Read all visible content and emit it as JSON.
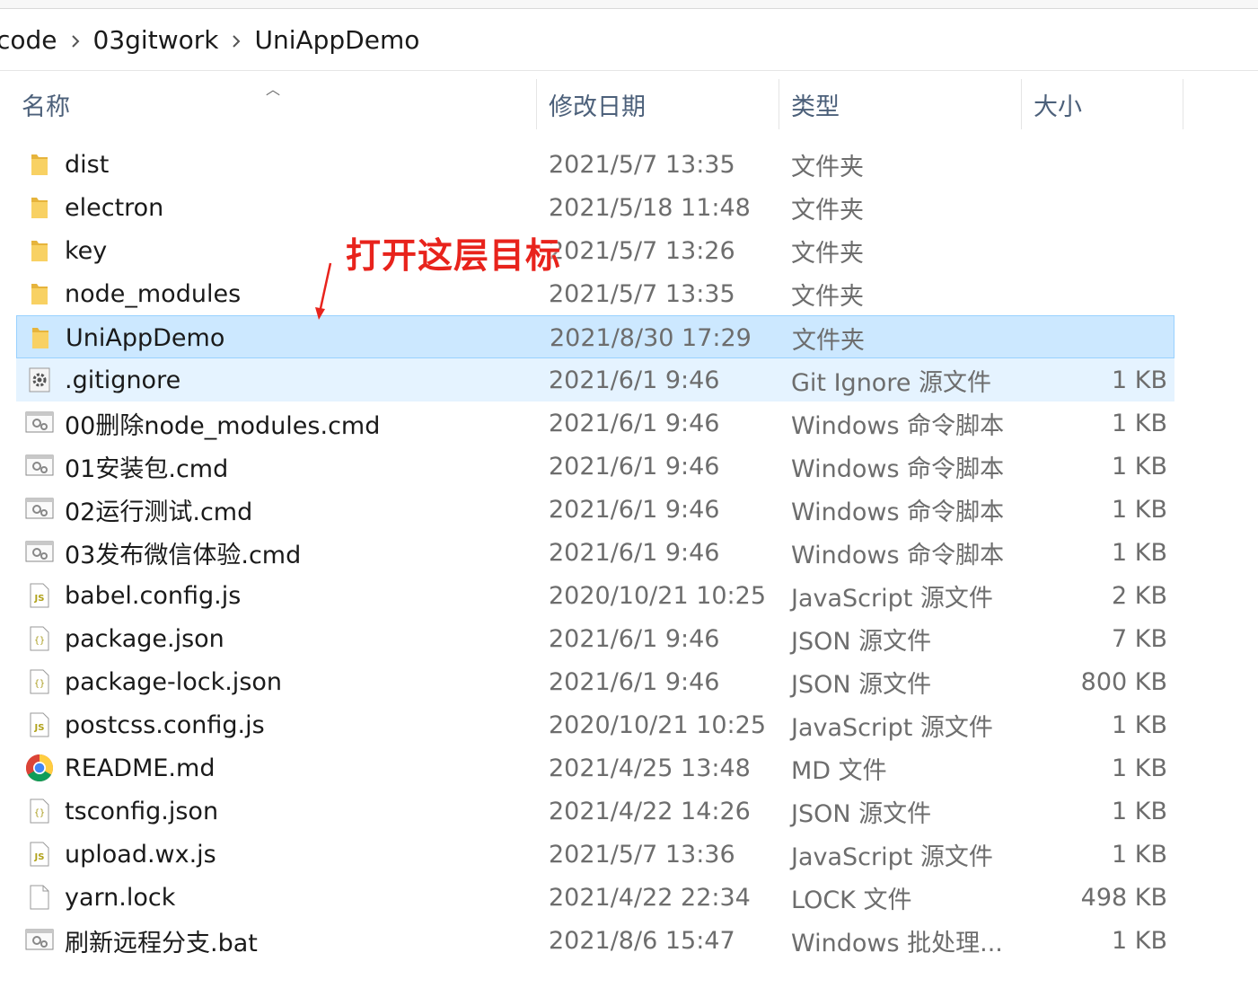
{
  "breadcrumb": [
    "code",
    "03gitwork",
    "UniAppDemo"
  ],
  "columns": {
    "name": "名称",
    "date": "修改日期",
    "type": "类型",
    "size": "大小"
  },
  "annotation": "打开这层目标",
  "colors": {
    "selected_bg": "#cce8ff",
    "annotation": "#e8231c",
    "folder": "#f8d163"
  },
  "files": [
    {
      "name": "dist",
      "date": "2021/5/7 13:35",
      "type": "文件夹",
      "size": "",
      "icon": "folder-icon"
    },
    {
      "name": "electron",
      "date": "2021/5/18 11:48",
      "type": "文件夹",
      "size": "",
      "icon": "folder-icon"
    },
    {
      "name": "key",
      "date": "2021/5/7 13:26",
      "type": "文件夹",
      "size": "",
      "icon": "folder-icon"
    },
    {
      "name": "node_modules",
      "date": "2021/5/7 13:35",
      "type": "文件夹",
      "size": "",
      "icon": "folder-icon"
    },
    {
      "name": "UniAppDemo",
      "date": "2021/8/30 17:29",
      "type": "文件夹",
      "size": "",
      "icon": "folder-icon",
      "state": "selected"
    },
    {
      "name": ".gitignore",
      "date": "2021/6/1 9:46",
      "type": "Git Ignore 源文件",
      "size": "1 KB",
      "icon": "gear-file-icon",
      "state": "hover"
    },
    {
      "name": "00删除node_modules.cmd",
      "date": "2021/6/1 9:46",
      "type": "Windows 命令脚本",
      "size": "1 KB",
      "icon": "cmd-script-icon"
    },
    {
      "name": "01安装包.cmd",
      "date": "2021/6/1 9:46",
      "type": "Windows 命令脚本",
      "size": "1 KB",
      "icon": "cmd-script-icon"
    },
    {
      "name": "02运行测试.cmd",
      "date": "2021/6/1 9:46",
      "type": "Windows 命令脚本",
      "size": "1 KB",
      "icon": "cmd-script-icon"
    },
    {
      "name": "03发布微信体验.cmd",
      "date": "2021/6/1 9:46",
      "type": "Windows 命令脚本",
      "size": "1 KB",
      "icon": "cmd-script-icon"
    },
    {
      "name": "babel.config.js",
      "date": "2020/10/21 10:25",
      "type": "JavaScript 源文件",
      "size": "2 KB",
      "icon": "js-file-icon"
    },
    {
      "name": "package.json",
      "date": "2021/6/1 9:46",
      "type": "JSON 源文件",
      "size": "7 KB",
      "icon": "json-file-icon"
    },
    {
      "name": "package-lock.json",
      "date": "2021/6/1 9:46",
      "type": "JSON 源文件",
      "size": "800 KB",
      "icon": "json-file-icon"
    },
    {
      "name": "postcss.config.js",
      "date": "2020/10/21 10:25",
      "type": "JavaScript 源文件",
      "size": "1 KB",
      "icon": "js-file-icon"
    },
    {
      "name": "README.md",
      "date": "2021/4/25 13:48",
      "type": "MD 文件",
      "size": "1 KB",
      "icon": "chrome-icon"
    },
    {
      "name": "tsconfig.json",
      "date": "2021/4/22 14:26",
      "type": "JSON 源文件",
      "size": "1 KB",
      "icon": "json-file-icon"
    },
    {
      "name": "upload.wx.js",
      "date": "2021/5/7 13:36",
      "type": "JavaScript 源文件",
      "size": "1 KB",
      "icon": "js-file-icon"
    },
    {
      "name": "yarn.lock",
      "date": "2021/4/22 22:34",
      "type": "LOCK 文件",
      "size": "498 KB",
      "icon": "blank-file-icon"
    },
    {
      "name": "刷新远程分支.bat",
      "date": "2021/8/6 15:47",
      "type": "Windows 批处理...",
      "size": "1 KB",
      "icon": "cmd-script-icon"
    }
  ]
}
